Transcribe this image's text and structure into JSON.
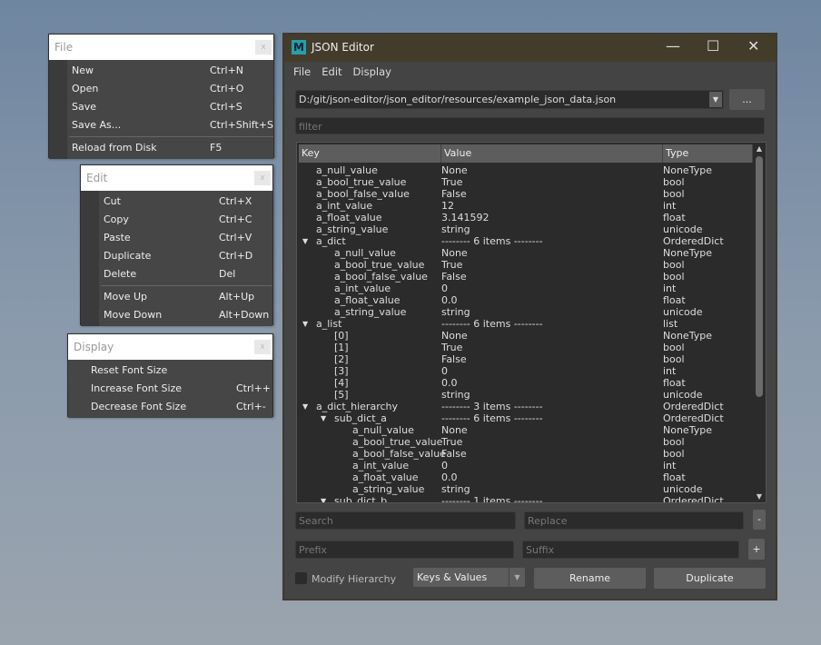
{
  "file_menu": {
    "title": "File",
    "items": [
      {
        "label": "New",
        "shortcut": "Ctrl+N"
      },
      {
        "label": "Open",
        "shortcut": "Ctrl+O"
      },
      {
        "label": "Save",
        "shortcut": "Ctrl+S"
      },
      {
        "label": "Save As...",
        "shortcut": "Ctrl+Shift+S"
      },
      {
        "label": "Reload from Disk",
        "shortcut": "F5"
      }
    ]
  },
  "edit_menu": {
    "title": "Edit",
    "items": [
      {
        "label": "Cut",
        "shortcut": "Ctrl+X"
      },
      {
        "label": "Copy",
        "shortcut": "Ctrl+C"
      },
      {
        "label": "Paste",
        "shortcut": "Ctrl+V"
      },
      {
        "label": "Duplicate",
        "shortcut": "Ctrl+D"
      },
      {
        "label": "Delete",
        "shortcut": "Del"
      },
      {
        "label": "Move Up",
        "shortcut": "Alt+Up"
      },
      {
        "label": "Move Down",
        "shortcut": "Alt+Down"
      }
    ]
  },
  "display_menu": {
    "title": "Display",
    "items": [
      {
        "label": "Reset Font Size",
        "shortcut": ""
      },
      {
        "label": "Increase Font Size",
        "shortcut": "Ctrl++"
      },
      {
        "label": "Decrease Font Size",
        "shortcut": "Ctrl+-"
      }
    ]
  },
  "window": {
    "title": "JSON Editor",
    "logo": "M",
    "menubar": [
      "File",
      "Edit",
      "Display"
    ],
    "path": "D:/git/json-editor/json_editor/resources/example_json_data.json",
    "browse": "...",
    "filter_placeholder": "filter",
    "columns": [
      "Key",
      "Value",
      "Type"
    ],
    "rows": [
      {
        "l": 0,
        "e": false,
        "k": "a_null_value",
        "v": "None",
        "t": "NoneType"
      },
      {
        "l": 0,
        "e": false,
        "k": "a_bool_true_value",
        "v": "True",
        "t": "bool"
      },
      {
        "l": 0,
        "e": false,
        "k": "a_bool_false_value",
        "v": "False",
        "t": "bool"
      },
      {
        "l": 0,
        "e": false,
        "k": "a_int_value",
        "v": "12",
        "t": "int"
      },
      {
        "l": 0,
        "e": false,
        "k": "a_float_value",
        "v": "3.141592",
        "t": "float"
      },
      {
        "l": 0,
        "e": false,
        "k": "a_string_value",
        "v": "string",
        "t": "unicode"
      },
      {
        "l": 0,
        "e": true,
        "k": "a_dict",
        "v": "-------- 6 items --------",
        "t": "OrderedDict"
      },
      {
        "l": 1,
        "e": false,
        "k": "a_null_value",
        "v": "None",
        "t": "NoneType"
      },
      {
        "l": 1,
        "e": false,
        "k": "a_bool_true_value",
        "v": "True",
        "t": "bool"
      },
      {
        "l": 1,
        "e": false,
        "k": "a_bool_false_value",
        "v": "False",
        "t": "bool"
      },
      {
        "l": 1,
        "e": false,
        "k": "a_int_value",
        "v": "0",
        "t": "int"
      },
      {
        "l": 1,
        "e": false,
        "k": "a_float_value",
        "v": "0.0",
        "t": "float"
      },
      {
        "l": 1,
        "e": false,
        "k": "a_string_value",
        "v": "string",
        "t": "unicode"
      },
      {
        "l": 0,
        "e": true,
        "k": "a_list",
        "v": "-------- 6 items --------",
        "t": "list"
      },
      {
        "l": 1,
        "e": false,
        "k": "[0]",
        "v": "None",
        "t": "NoneType"
      },
      {
        "l": 1,
        "e": false,
        "k": "[1]",
        "v": "True",
        "t": "bool"
      },
      {
        "l": 1,
        "e": false,
        "k": "[2]",
        "v": "False",
        "t": "bool"
      },
      {
        "l": 1,
        "e": false,
        "k": "[3]",
        "v": "0",
        "t": "int"
      },
      {
        "l": 1,
        "e": false,
        "k": "[4]",
        "v": "0.0",
        "t": "float"
      },
      {
        "l": 1,
        "e": false,
        "k": "[5]",
        "v": "string",
        "t": "unicode"
      },
      {
        "l": 0,
        "e": true,
        "k": "a_dict_hierarchy",
        "v": "-------- 3 items --------",
        "t": "OrderedDict"
      },
      {
        "l": 1,
        "e": true,
        "k": "sub_dict_a",
        "v": "-------- 6 items --------",
        "t": "OrderedDict"
      },
      {
        "l": 2,
        "e": false,
        "k": "a_null_value",
        "v": "None",
        "t": "NoneType"
      },
      {
        "l": 2,
        "e": false,
        "k": "a_bool_true_value",
        "v": "True",
        "t": "bool"
      },
      {
        "l": 2,
        "e": false,
        "k": "a_bool_false_value",
        "v": "False",
        "t": "bool"
      },
      {
        "l": 2,
        "e": false,
        "k": "a_int_value",
        "v": "0",
        "t": "int"
      },
      {
        "l": 2,
        "e": false,
        "k": "a_float_value",
        "v": "0.0",
        "t": "float"
      },
      {
        "l": 2,
        "e": false,
        "k": "a_string_value",
        "v": "string",
        "t": "unicode"
      },
      {
        "l": 1,
        "e": true,
        "k": "sub_dict_b",
        "v": "-------- 1 items --------",
        "t": "OrderedDict"
      }
    ],
    "search_placeholder": "Search",
    "replace_placeholder": "Replace",
    "minus": "-",
    "prefix_placeholder": "Prefix",
    "suffix_placeholder": "Suffix",
    "plus": "+",
    "modify_hierarchy": "Modify Hierarchy",
    "modify_hierarchy_checked": false,
    "mode": "Keys & Values",
    "rename": "Rename",
    "duplicate": "Duplicate"
  }
}
